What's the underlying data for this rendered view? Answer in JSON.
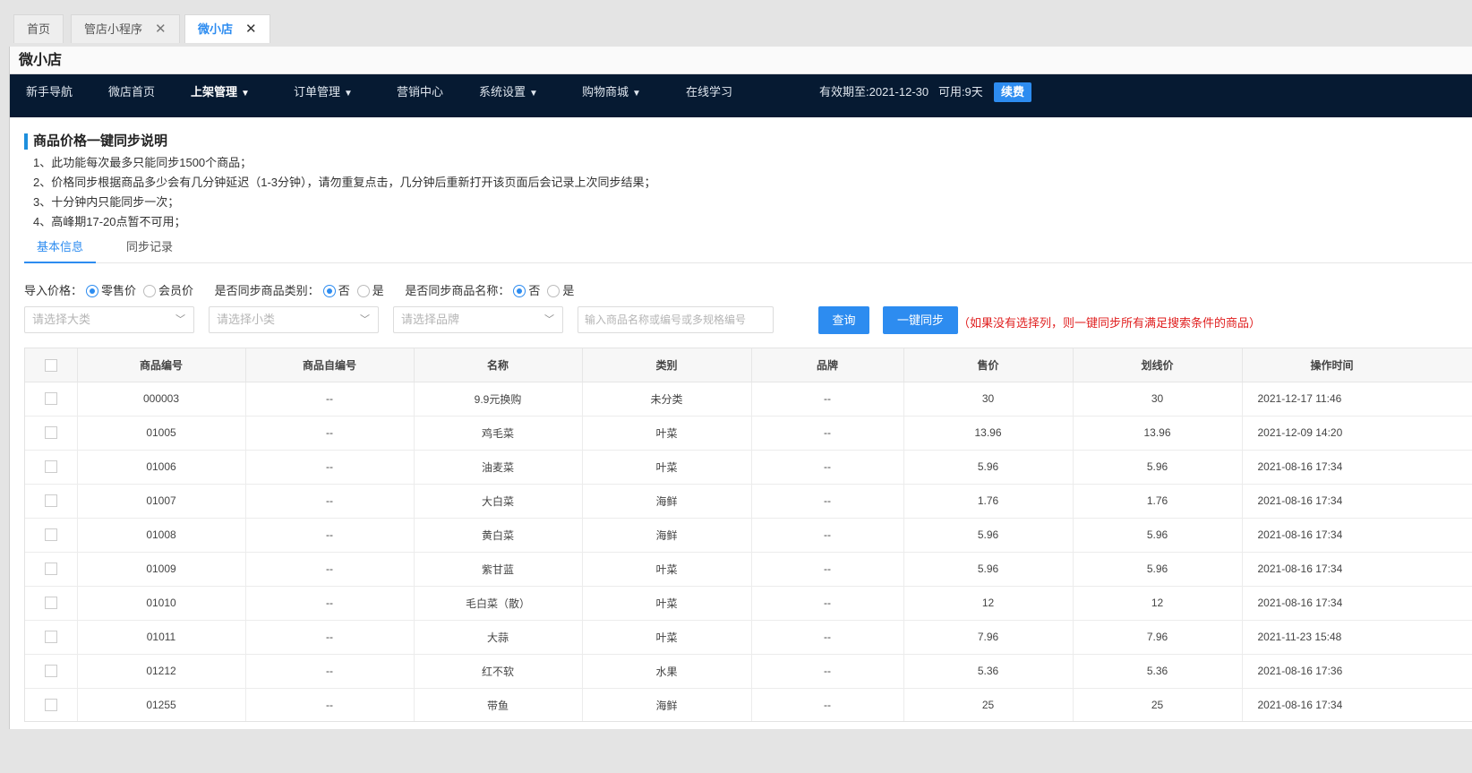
{
  "tabs": [
    {
      "label": "首页",
      "closable": false,
      "active": false
    },
    {
      "label": "管店小程序",
      "closable": true,
      "active": false
    },
    {
      "label": "微小店",
      "closable": true,
      "active": true
    }
  ],
  "page_title": "微小店",
  "nav": {
    "items": [
      {
        "label": "新手导航",
        "dropdown": false
      },
      {
        "label": "微店首页",
        "dropdown": false
      },
      {
        "label": "上架管理",
        "dropdown": true,
        "active": true
      },
      {
        "label": "订单管理",
        "dropdown": true
      },
      {
        "label": "营销中心",
        "dropdown": false
      },
      {
        "label": "系统设置",
        "dropdown": true
      },
      {
        "label": "购物商城",
        "dropdown": true
      },
      {
        "label": "在线学习",
        "dropdown": false
      }
    ],
    "expire_text": "有效期至:2021-12-30   可用:9天",
    "renew_label": "续费"
  },
  "info": {
    "title": "商品价格一键同步说明",
    "lines": [
      "1、此功能每次最多只能同步1500个商品；",
      "2、价格同步根据商品多少会有几分钟延迟（1-3分钟），请勿重复点击，几分钟后重新打开该页面后会记录上次同步结果；",
      "3、十分钟内只能同步一次；",
      "4、高峰期17-20点暂不可用；"
    ]
  },
  "subtabs": [
    "基本信息",
    "同步记录"
  ],
  "filters": {
    "import_price_label": "导入价格：",
    "import_price_options": [
      "零售价",
      "会员价"
    ],
    "sync_category_label": "是否同步商品类别：",
    "sync_name_label": "是否同步商品名称：",
    "yes_no_options": [
      "否",
      "是"
    ],
    "category_placeholder": "请选择大类",
    "subcategory_placeholder": "请选择小类",
    "brand_placeholder": "请选择品牌",
    "search_placeholder": "输入商品名称或编号或多规格编号",
    "query_label": "查询",
    "sync_label": "一键同步",
    "hint": "（如果没有选择列，则一键同步所有满足搜索条件的商品）"
  },
  "table": {
    "columns": [
      "商品编号",
      "商品自编号",
      "名称",
      "类别",
      "品牌",
      "售价",
      "划线价",
      "操作时间"
    ],
    "rows": [
      [
        "000003",
        "--",
        "9.9元换购",
        "未分类",
        "--",
        "30",
        "30",
        "2021-12-17 11:46"
      ],
      [
        "01005",
        "--",
        "鸡毛菜",
        "叶菜",
        "--",
        "13.96",
        "13.96",
        "2021-12-09 14:20"
      ],
      [
        "01006",
        "--",
        "油麦菜",
        "叶菜",
        "--",
        "5.96",
        "5.96",
        "2021-08-16 17:34"
      ],
      [
        "01007",
        "--",
        "大白菜",
        "海鲜",
        "--",
        "1.76",
        "1.76",
        "2021-08-16 17:34"
      ],
      [
        "01008",
        "--",
        "黄白菜",
        "海鲜",
        "--",
        "5.96",
        "5.96",
        "2021-08-16 17:34"
      ],
      [
        "01009",
        "--",
        "紫甘蓝",
        "叶菜",
        "--",
        "5.96",
        "5.96",
        "2021-08-16 17:34"
      ],
      [
        "01010",
        "--",
        "毛白菜（散）",
        "叶菜",
        "--",
        "12",
        "12",
        "2021-08-16 17:34"
      ],
      [
        "01011",
        "--",
        "大蒜",
        "叶菜",
        "--",
        "7.96",
        "7.96",
        "2021-11-23 15:48"
      ],
      [
        "01212",
        "--",
        "红不软",
        "水果",
        "--",
        "5.36",
        "5.36",
        "2021-08-16 17:36"
      ],
      [
        "01255",
        "--",
        "带鱼",
        "海鲜",
        "--",
        "25",
        "25",
        "2021-08-16 17:34"
      ]
    ]
  }
}
